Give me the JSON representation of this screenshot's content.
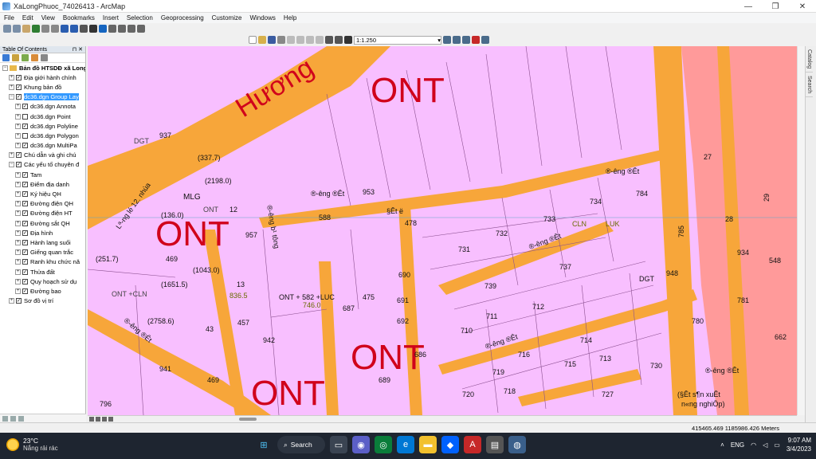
{
  "window": {
    "title": "XaLongPhuoc_74026413 - ArcMap",
    "controls": [
      "—",
      "❐",
      "✕"
    ]
  },
  "menu": [
    "File",
    "Edit",
    "View",
    "Bookmarks",
    "Insert",
    "Selection",
    "Geoprocessing",
    "Customize",
    "Windows",
    "Help"
  ],
  "toolbar": {
    "scale": "1:1.250"
  },
  "toc": {
    "title": "Table Of Contents",
    "layers": [
      {
        "label": "Bản đồ HTSDĐ xã Long",
        "indent": 0,
        "exp": "−",
        "check": false,
        "bold": true
      },
      {
        "label": "Địa giới hành chính",
        "indent": 1,
        "exp": "+",
        "check": true
      },
      {
        "label": "Khung bản đồ",
        "indent": 1,
        "exp": "+",
        "check": true
      },
      {
        "label": "dc36.dgn Group Lay",
        "indent": 1,
        "exp": "−",
        "check": true,
        "selected": true
      },
      {
        "label": "dc36.dgn Annota",
        "indent": 2,
        "exp": "+",
        "check": true
      },
      {
        "label": "dc36.dgn Point",
        "indent": 2,
        "exp": "+",
        "check": false
      },
      {
        "label": "dc36.dgn Polyline",
        "indent": 2,
        "exp": "+",
        "check": true
      },
      {
        "label": "dc36.dgn Polygon",
        "indent": 2,
        "exp": "+",
        "check": false
      },
      {
        "label": "dc36.dgn MultiPa",
        "indent": 2,
        "exp": "+",
        "check": true
      },
      {
        "label": "Chú dẫn và ghi chú",
        "indent": 1,
        "exp": "+",
        "check": true
      },
      {
        "label": "Các yếu tố chuyên đ",
        "indent": 1,
        "exp": "−",
        "check": true
      },
      {
        "label": "Tam",
        "indent": 2,
        "exp": "+",
        "check": true
      },
      {
        "label": "Điểm địa danh",
        "indent": 2,
        "exp": "+",
        "check": true
      },
      {
        "label": "Ký hiệu QH",
        "indent": 2,
        "exp": "+",
        "check": true
      },
      {
        "label": "Đường điện QH",
        "indent": 2,
        "exp": "+",
        "check": true
      },
      {
        "label": "Đường điện HT",
        "indent": 2,
        "exp": "+",
        "check": true
      },
      {
        "label": "Đường sắt QH",
        "indent": 2,
        "exp": "+",
        "check": true
      },
      {
        "label": "Địa hình",
        "indent": 2,
        "exp": "+",
        "check": true
      },
      {
        "label": "Hành lang suối",
        "indent": 2,
        "exp": "+",
        "check": true
      },
      {
        "label": "Giếng quan trắc",
        "indent": 2,
        "exp": "+",
        "check": true
      },
      {
        "label": "Ranh khu chức nă",
        "indent": 2,
        "exp": "+",
        "check": true
      },
      {
        "label": "Thửa đất",
        "indent": 2,
        "exp": "+",
        "check": true
      },
      {
        "label": "Quy hoạch sử dụ",
        "indent": 2,
        "exp": "+",
        "check": true
      },
      {
        "label": "Đường bao",
        "indent": 2,
        "exp": "+",
        "check": true
      },
      {
        "label": "Sơ đồ vị trí",
        "indent": 1,
        "exp": "+",
        "check": true
      }
    ]
  },
  "map": {
    "colors": {
      "land": "#f8bfff",
      "road": "#f7a63a",
      "commercial": "#ff9a9a",
      "label": "#d0021b"
    },
    "zone_labels": [
      "ONT",
      "ONT",
      "ONT",
      "ONT",
      "ONT"
    ],
    "road_name": "Hương",
    "labels": [
      "937",
      "DGT",
      "(337.7)",
      "(2198.0)",
      "MLG",
      "(136.0)",
      "ONT",
      "12",
      "957",
      "(251.7)",
      "469",
      "(1043.0)",
      "(1651.5)",
      "13",
      "836.5",
      "ONT +CLN",
      "(2758.6)",
      "43",
      "457",
      "942",
      "941",
      "469",
      "796",
      "588",
      "§Êt ë",
      "478",
      "953",
      "ONT + 582 +LUC",
      "746.0",
      "475",
      "690",
      "691",
      "692",
      "687",
      "686",
      "689",
      "731",
      "732",
      "733",
      "734",
      "784",
      "737",
      "739",
      "712",
      "711",
      "710",
      "716",
      "714",
      "713",
      "715",
      "719",
      "718",
      "720",
      "727",
      "730",
      "780",
      "781",
      "934",
      "27",
      "28",
      "29",
      "548",
      "662",
      "785",
      "948",
      "DGT",
      "CLN",
      "LUK",
      "(§Êt s¶n xuÊt",
      "n«ng nghiÖp)",
      "Lª-ng lé 12. nhùa",
      "®-êng b¹ tông",
      "®-êng ®Êt",
      "®-êng ®Êt",
      "®-êng ®Êt",
      "®-êng ®Êt",
      "®-êng ®Êt",
      "®-êng ®Êt"
    ]
  },
  "status": {
    "coords": "415465.469  1185986.426 Meters"
  },
  "side_tabs": [
    "Catalog",
    "Search"
  ],
  "taskbar": {
    "weather_temp": "23°C",
    "weather_desc": "Nắng rải rác",
    "search_label": "Search",
    "lang": "ENG",
    "time": "9:07 AM",
    "date": "3/4/2023"
  }
}
